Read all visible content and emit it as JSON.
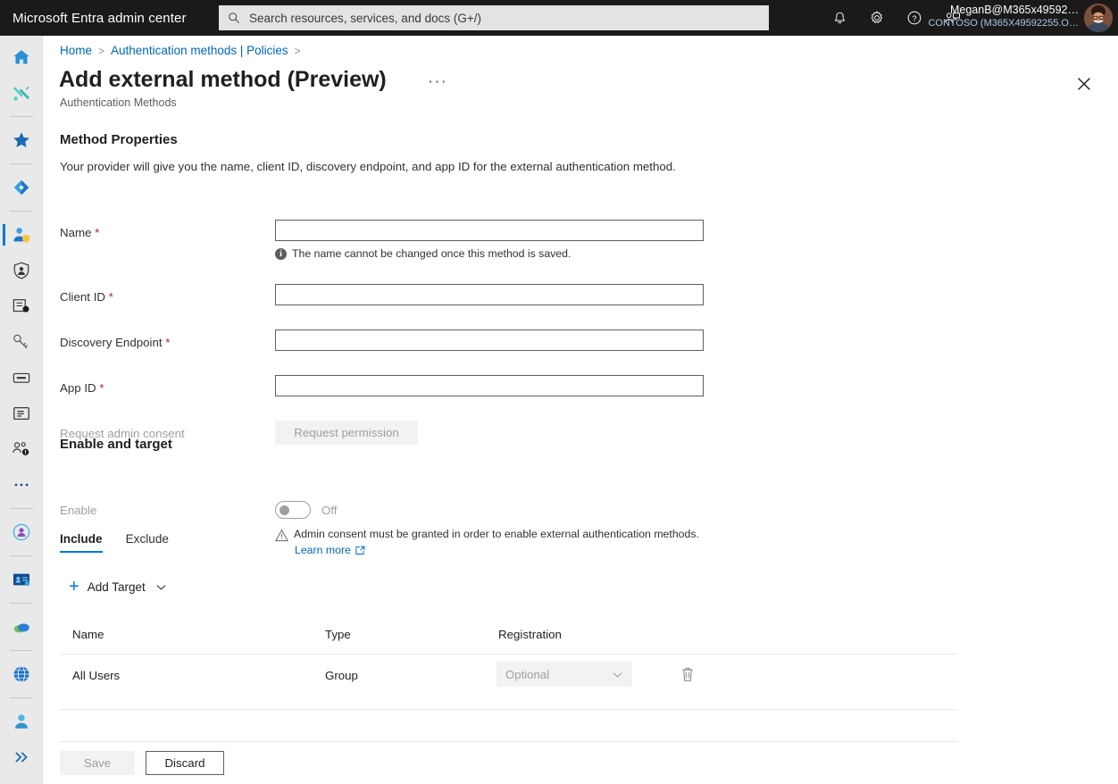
{
  "topbar": {
    "brand": "Microsoft Entra admin center",
    "search_placeholder": "Search resources, services, and docs (G+/)",
    "search_value": "",
    "icons": [
      "notification-bell-icon",
      "settings-gear-icon",
      "help-question-icon",
      "feedback-icon"
    ],
    "account_name": "MeganB@M365x49592…",
    "account_tenant": "CONTOSO (M365X49592255.O…"
  },
  "rail": {
    "items": [
      {
        "name": "home",
        "icon": "home-icon"
      },
      {
        "name": "diagnose-solve",
        "icon": "tools-icon"
      },
      {
        "name": "favorites",
        "icon": "star-icon"
      },
      {
        "name": "entra-id",
        "icon": "entra-diamond-icon"
      },
      {
        "name": "identity",
        "icon": "user-shield-icon",
        "active": true
      },
      {
        "name": "protection",
        "icon": "person-shield-icon"
      },
      {
        "name": "identity-governance",
        "icon": "governance-icon"
      },
      {
        "name": "verified-id",
        "icon": "keys-icon"
      },
      {
        "name": "permissions-management",
        "icon": "card-icon"
      },
      {
        "name": "learn-support",
        "icon": "document-icon"
      },
      {
        "name": "users-alert",
        "icon": "users-alert-icon"
      },
      {
        "name": "show-more",
        "icon": "ellipsis-icon"
      },
      {
        "name": "identity-protection",
        "icon": "identity-protection-icon"
      },
      {
        "name": "verified-id-badge",
        "icon": "id-badge-icon"
      },
      {
        "name": "defender-cloud",
        "icon": "cloud-icon"
      },
      {
        "name": "global-secure-access",
        "icon": "globe-icon"
      },
      {
        "name": "support",
        "icon": "support-person-icon"
      },
      {
        "name": "expand-menu",
        "icon": "chevron-double-right-icon"
      }
    ]
  },
  "breadcrumb": {
    "items": [
      "Home",
      "Authentication methods | Policies"
    ]
  },
  "page": {
    "title": "Add external method (Preview)",
    "ellipsis": "···",
    "subtitle": "Authentication Methods",
    "close_label": "close-icon"
  },
  "method_properties": {
    "heading": "Method Properties",
    "description": "Your provider will give you the name, client ID, discovery endpoint, and app ID for the external authentication method.",
    "fields": [
      {
        "label": "Name",
        "required": true,
        "value": "",
        "hint": "The name cannot be changed once this method is saved."
      },
      {
        "label": "Client ID",
        "required": true,
        "value": ""
      },
      {
        "label": "Discovery Endpoint",
        "required": true,
        "value": ""
      },
      {
        "label": "App ID",
        "required": true,
        "value": ""
      }
    ],
    "consent_label": "Request admin consent",
    "consent_button": "Request permission"
  },
  "enable_target": {
    "heading": "Enable and target",
    "enable_label": "Enable",
    "toggle_state": "Off",
    "warning": "Admin consent must be granted in order to enable external authentication methods.",
    "learn_more": "Learn more"
  },
  "tabs": [
    {
      "label": "Include",
      "active": true
    },
    {
      "label": "Exclude",
      "active": false
    }
  ],
  "add_target": {
    "label": "Add Target"
  },
  "table": {
    "columns": [
      "Name",
      "Type",
      "Registration"
    ],
    "rows": [
      {
        "name": "All Users",
        "type": "Group",
        "registration": "Optional"
      }
    ]
  },
  "footer": {
    "save_label": "Save",
    "discard_label": "Discard"
  },
  "colors": {
    "accent": "#0078d4",
    "link": "#0067b8",
    "topbar_bg": "#1b1a19",
    "rail_bg": "#e9e9e9",
    "required_red": "#a4262c"
  }
}
